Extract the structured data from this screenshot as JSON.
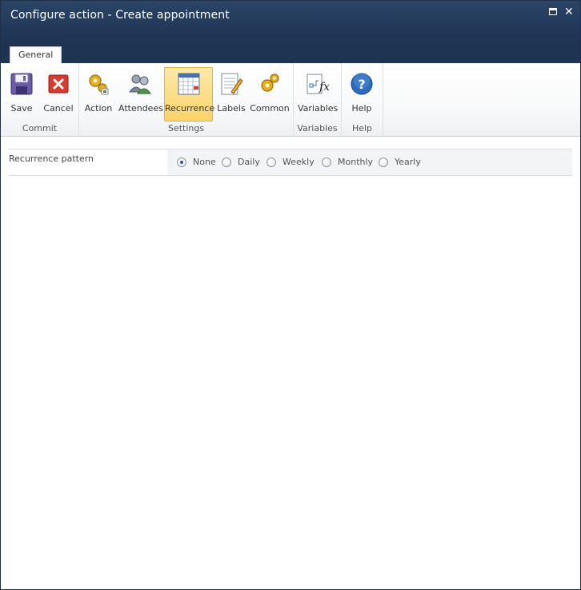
{
  "window": {
    "title": "Configure action - Create appointment"
  },
  "tabs": [
    {
      "label": "General"
    }
  ],
  "ribbon": {
    "groups": [
      {
        "label": "Commit",
        "buttons": [
          {
            "label": "Save",
            "icon": "floppy-disk-icon"
          },
          {
            "label": "Cancel",
            "icon": "red-x-icon"
          }
        ]
      },
      {
        "label": "Settings",
        "buttons": [
          {
            "label": "Action",
            "icon": "gears-icon"
          },
          {
            "label": "Attendees",
            "icon": "people-icon"
          },
          {
            "label": "Recurrence",
            "icon": "calendar-icon",
            "active": true
          },
          {
            "label": "Labels",
            "icon": "notepad-pencil-icon"
          },
          {
            "label": "Common",
            "icon": "gear-icon"
          }
        ]
      },
      {
        "label": "Variables",
        "buttons": [
          {
            "label": "Variables",
            "icon": "fx-variable-icon"
          }
        ]
      },
      {
        "label": "Help",
        "buttons": [
          {
            "label": "Help",
            "icon": "help-question-icon"
          }
        ]
      }
    ]
  },
  "form": {
    "recurrence_label": "Recurrence pattern",
    "options": [
      "None",
      "Daily",
      "Weekly",
      "Monthly",
      "Yearly"
    ],
    "selected": "None"
  },
  "colors": {
    "titlebar": "#22395a",
    "active_button": "#fbd36a",
    "accent": "#2a5a96"
  }
}
